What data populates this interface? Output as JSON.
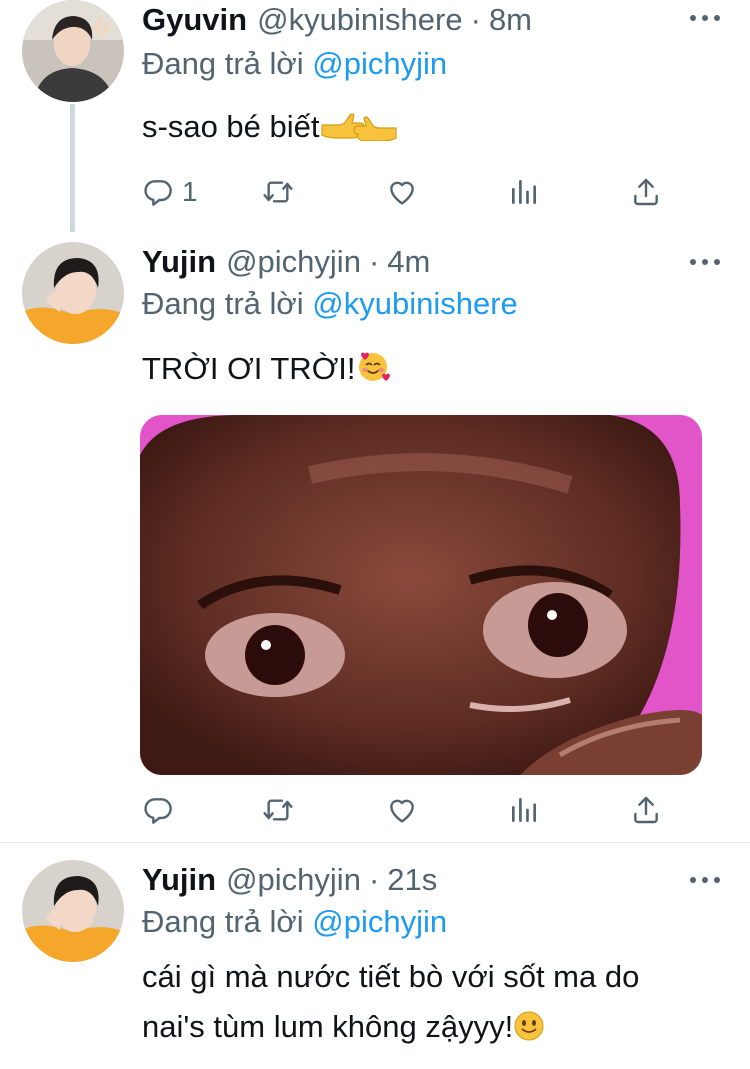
{
  "tweets": [
    {
      "name": "Gyuvin",
      "handle": "@kyubinishere",
      "separator": "·",
      "time": "8m",
      "reply_prefix": "Đang trả lời",
      "reply_to": "@pichyjin",
      "text": "s-sao bé biết",
      "reply_count": "1",
      "emoji_desc": "pointing-hands"
    },
    {
      "name": "Yujin",
      "handle": "@pichyjin",
      "separator": "·",
      "time": "4m",
      "reply_prefix": "Đang trả lời",
      "reply_to": "@kyubinishere",
      "text": "TRỜI ƠI TRỜI!",
      "reply_count": "",
      "emoji_desc": "smiling-face-with-hearts"
    },
    {
      "name": "Yujin",
      "handle": "@pichyjin",
      "separator": "·",
      "time": "21s",
      "reply_prefix": "Đang trả lời",
      "reply_to": "@pichyjin",
      "text_line1": "cái gì mà nước tiết bò với sốt ma do",
      "text_line2": "nai's tùm lum không zậyyy!",
      "emoji_desc": "slightly-smiling-face"
    }
  ],
  "colors": {
    "accent": "#1d9bf0",
    "secondary_text": "#536471",
    "primary_text": "#0f1419",
    "thread_line": "#cfd9de"
  }
}
